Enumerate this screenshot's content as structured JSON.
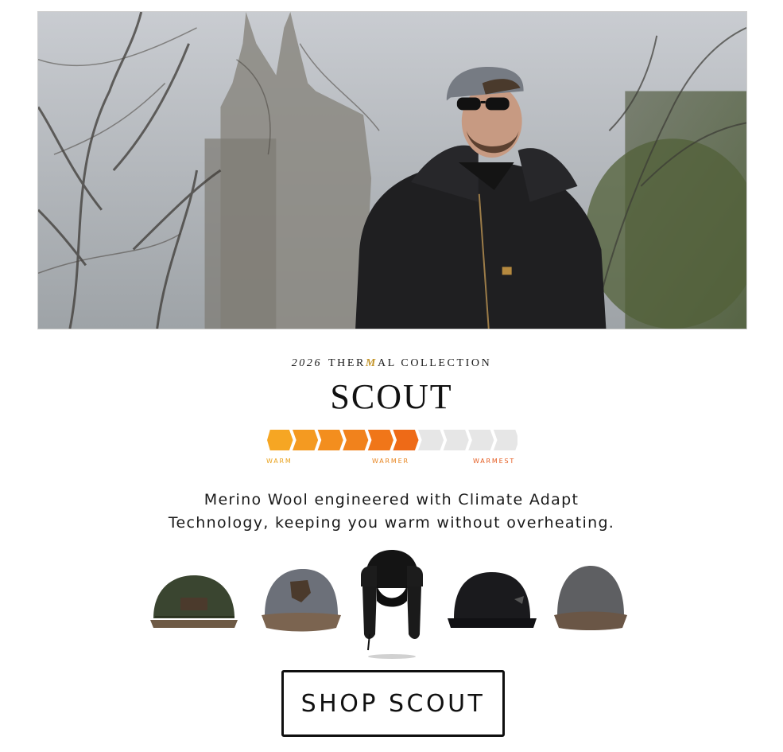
{
  "hero": {
    "alt": "Smiling man wearing a grey cap, sunglasses and a black hooded work jacket in a park with bare trees"
  },
  "headline": {
    "year": "2026",
    "eyebrow_pre": "THER",
    "eyebrow_mark": "M",
    "eyebrow_post": "AL COLLECTION",
    "title": "SCOUT"
  },
  "warmth_meter": {
    "level": 6,
    "segments": 10,
    "labels": {
      "low": "WARM",
      "mid": "WARMER",
      "high": "WARMEST"
    },
    "colors": {
      "start": "#f6a623",
      "end": "#ee6a17",
      "empty": "#e6e6e6"
    }
  },
  "description": {
    "line1": "Merino Wool engineered with Climate Adapt",
    "line2": "Technology, keeping you warm without overheating."
  },
  "hats": [
    {
      "name": "green-wool-snapback",
      "colors": {
        "crown": "#3a4530",
        "brim": "#6e5a45"
      }
    },
    {
      "name": "grey-wool-trucker",
      "colors": {
        "crown": "#6c7079",
        "brim": "#7b6450"
      }
    },
    {
      "name": "black-trapper-hat",
      "colors": {
        "crown": "#141414",
        "brim": "#1c1c1c"
      }
    },
    {
      "name": "black-wool-snapback",
      "colors": {
        "crown": "#1a1a1d",
        "brim": "#111114"
      }
    },
    {
      "name": "grey-wool-curved",
      "colors": {
        "crown": "#5e5f62",
        "brim": "#6a5646"
      }
    }
  ],
  "cta": {
    "label": "SHOP SCOUT"
  }
}
